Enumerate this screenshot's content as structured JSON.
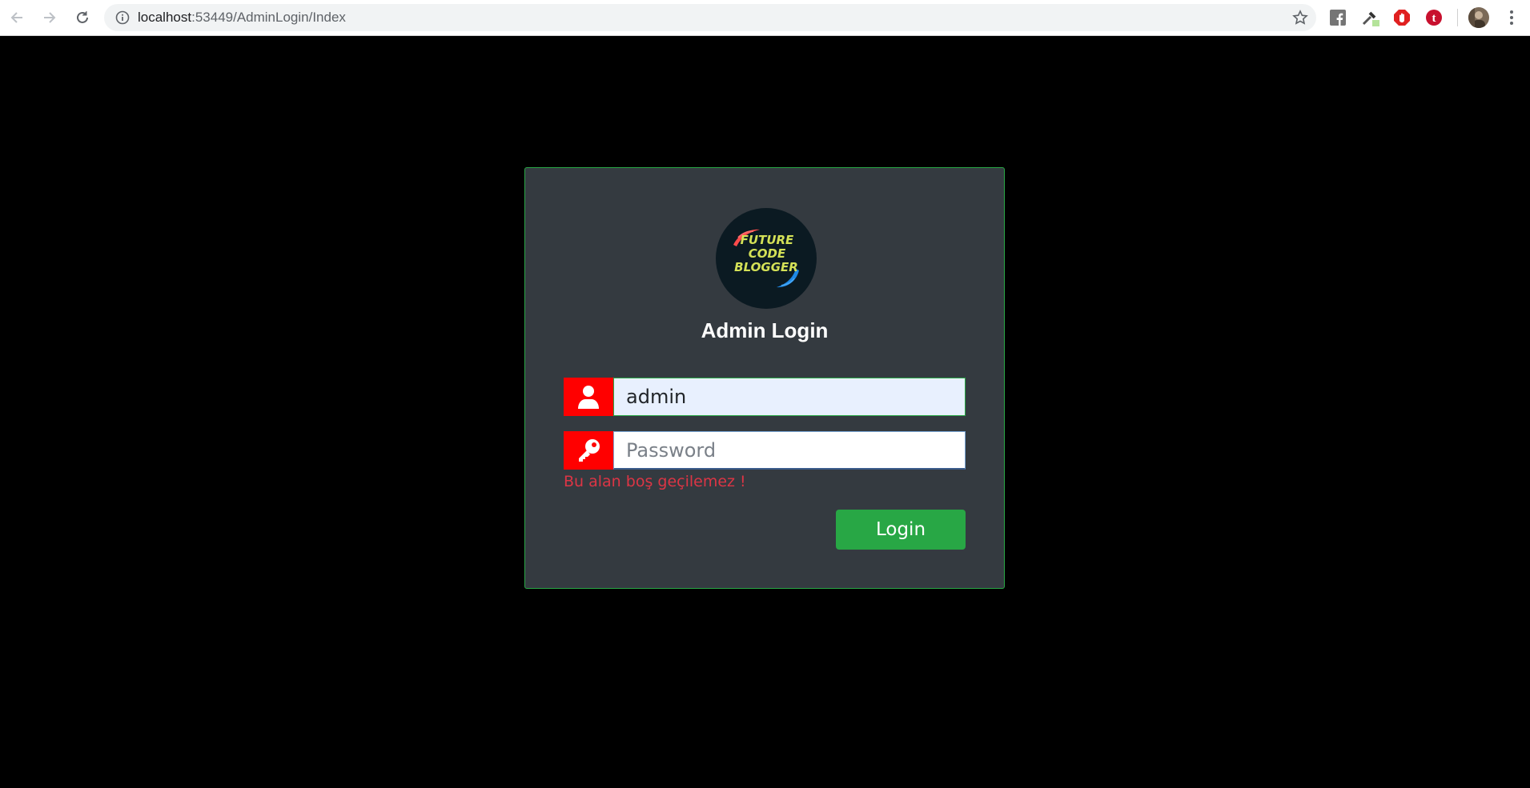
{
  "browser": {
    "url_host": "localhost",
    "url_path": ":53449/AdminLogin/Index"
  },
  "icons": {
    "back": "back-arrow-icon",
    "forward": "forward-arrow-icon",
    "reload": "reload-icon",
    "info": "info-icon",
    "star": "star-icon",
    "extensions": [
      "facebook-icon",
      "eyedropper-icon",
      "adblock-icon",
      "t-extension-icon"
    ],
    "avatar": "profile-avatar",
    "menu": "kebab-menu-icon",
    "user": "user-icon",
    "key": "key-icon"
  },
  "logo": {
    "line1": "FUTURE",
    "line2": "CODE",
    "line3": "BLOGGER"
  },
  "login": {
    "title": "Admin Login",
    "username_value": "admin",
    "password_placeholder": "Password",
    "error_message": "Bu alan boş geçilemez !",
    "submit_label": "Login"
  },
  "colors": {
    "page_background": "#000000",
    "card_background": "#343a40",
    "card_border": "#28a745",
    "addon_background": "#ff0000",
    "button_background": "#28a745",
    "error_text": "#dc3545",
    "logo_text": "#d4e157"
  }
}
